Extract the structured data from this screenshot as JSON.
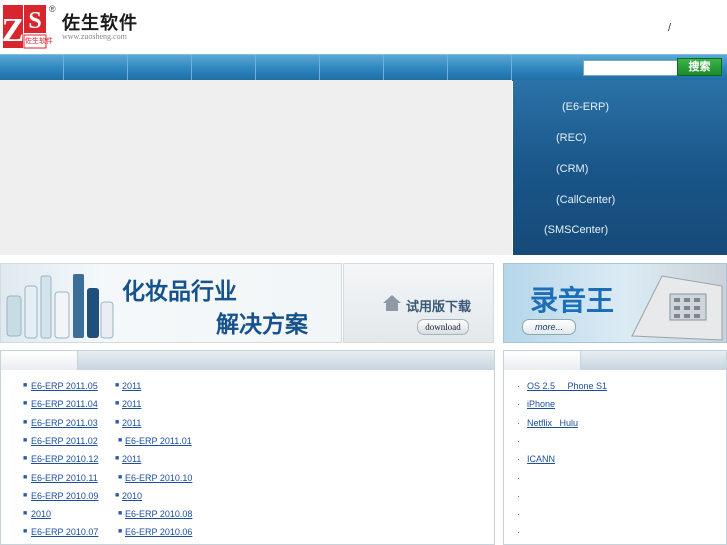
{
  "header": {
    "logo_letters": "ZS",
    "logo_small_text": "佐生软件",
    "title": "佐生软件",
    "url": "www.zuosheng.com",
    "top_links_separator": "/"
  },
  "nav": {
    "items_count_visual": 8
  },
  "search": {
    "placeholder": "",
    "button_label": "搜索"
  },
  "products": [
    {
      "label": "(E6-ERP)"
    },
    {
      "label": "(REC)"
    },
    {
      "label": "(CRM)"
    },
    {
      "label": "(CallCenter)"
    },
    {
      "label": "(SMSCenter)"
    }
  ],
  "promos": {
    "cosmetics_line1": "化妆品行业",
    "cosmetics_line2": "解决方案",
    "trial_title": "试用版下载",
    "trial_button": "download",
    "recorder_title": "录音王",
    "recorder_more": "more..."
  },
  "news_left": [
    [
      "E6-ERP 2011.05",
      "2011"
    ],
    [
      "E6-ERP 2011.04",
      "2011"
    ],
    [
      "E6-ERP 2011.03",
      "2011"
    ],
    [
      "E6-ERP 2011.02",
      "E6-ERP 2011.01"
    ],
    [
      "E6-ERP 2010.12",
      "2011"
    ],
    [
      "E6-ERP 2010.11",
      "E6-ERP 2010.10"
    ],
    [
      "E6-ERP 2010.09",
      "2010"
    ],
    [
      "2010",
      "E6-ERP 2010.08"
    ],
    [
      "E6-ERP 2010.07",
      "E6-ERP 2010.06"
    ]
  ],
  "news_right": [
    "OS 2.5     Phone S1",
    "iPhone",
    "Netflix   Hulu",
    "",
    "ICANN",
    "",
    "",
    "",
    ""
  ]
}
